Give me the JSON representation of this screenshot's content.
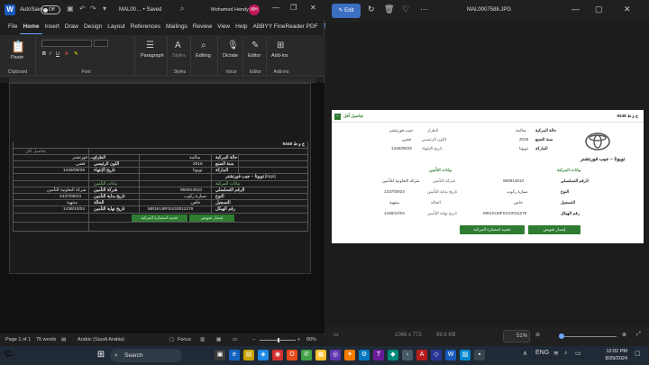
{
  "word": {
    "autosave_label": "AutoSave",
    "autosave_state": "Off",
    "doc_title": "MAL00… • Saved",
    "user_name": "Mohamed Hendy",
    "user_initials": "MH",
    "tabs": [
      "File",
      "Home",
      "Insert",
      "Draw",
      "Design",
      "Layout",
      "References",
      "Mailings",
      "Review",
      "View",
      "Help",
      "ABBYY FineReader PDF",
      "Table"
    ],
    "active_tab": "Home",
    "ribbon": {
      "paste": "Paste",
      "clipboard": "Clipboard",
      "font": "Font",
      "paragraph": "Paragraph",
      "styles": "Styles",
      "styles_group": "Styles",
      "editing": "Editing",
      "dictate": "Dictate",
      "voice": "Voice",
      "editor": "Editor",
      "editor_group": "Editor",
      "addins": "Add-ins",
      "addins_group": "Add-ins"
    },
    "doc": {
      "plate": "ج و ط 9348",
      "details_link": "تفاصيل أقل",
      "logo": "[logo]",
      "rows": [
        {
          "a": "حالة المركبة",
          "b": "سالمة",
          "c": "الطراز",
          "d": "جيب فورتشنر"
        },
        {
          "a": "سنة الصنع",
          "b": "2016",
          "c": "اللون الرئيسي",
          "d": "فضي"
        },
        {
          "a": "الماركة",
          "b": "تويوتا",
          "c": "تاريخ الإنتهاء",
          "d": "1446/09/25"
        },
        {
          "a": "تويوتا – جيب فورتشنر",
          "b": "",
          "c": "",
          "d": ""
        },
        {
          "a": "بيانات المركبة",
          "b": "",
          "c": "بيانات التأمين",
          "d": ""
        },
        {
          "a": "الرقم التسلسلي",
          "b": "950914510",
          "c": "شركة التأمين",
          "d": "شركة التعاونية للتأمين"
        },
        {
          "a": "النوع",
          "b": "سيارة ركوب",
          "c": "تاريخ بداية التأمين",
          "d": "1437/09/24"
        },
        {
          "a": "التسجيل",
          "b": "خاص",
          "c": "الحالة",
          "d": "منتهية"
        },
        {
          "a": "رقم الهيكل",
          "b": "MR1KU8FS1G0011276",
          "c": "تاريخ نهاية التأمين",
          "d": "1438/10/04"
        }
      ],
      "btn_issue": "إصدار تفويض",
      "btn_renew": "تجديد استمارة المركبة"
    },
    "status": {
      "page": "Page 1 of 1",
      "words": "75 words",
      "language": "Arabic (Saudi Arabia)",
      "focus": "Focus",
      "zoom": "80%"
    }
  },
  "photos": {
    "edit": "Edit",
    "file_name": "MAL0007588.JPG",
    "dimensions": "1069 x 772",
    "size": "99.6 KB",
    "zoom": "51%",
    "image": {
      "plate": "ج و ط 9348",
      "details_link": "تفاصيل أقل",
      "car_title": "تويوتا – جيب فورتشنر",
      "vehicle_section": "بيانات المركبة",
      "insurance_section": "بيانات التأمين",
      "fields_top": [
        {
          "label": "حالة المركبة",
          "value": "سالمة"
        },
        {
          "label": "سنة الصنع",
          "value": "2016"
        },
        {
          "label": "الماركة",
          "value": "تويوتا"
        }
      ],
      "fields_top_right": [
        {
          "label": "الطراز",
          "value": "جيب فورتشنر"
        },
        {
          "label": "اللون الرئيسي",
          "value": "فضي"
        },
        {
          "label": "تاريخ الإنتهاء",
          "value": "1446/09/25"
        }
      ],
      "vehicle_fields": [
        {
          "label": "الرقم التسلسلي",
          "value": "950914510"
        },
        {
          "label": "النوع",
          "value": "سيارة ركوب"
        },
        {
          "label": "التسجيل",
          "value": "خاص"
        },
        {
          "label": "رقم الهيكل",
          "value": "MR1KU8FS1G0011276"
        }
      ],
      "insurance_fields": [
        {
          "label": "شركة التأمين",
          "value": "شركة التعاونية للتأمين"
        },
        {
          "label": "تاريخ بداية التأمين",
          "value": "1437/09/24"
        },
        {
          "label": "الحالة",
          "value": "منتهية"
        },
        {
          "label": "تاريخ نهاية التأمين",
          "value": "1438/10/04"
        }
      ],
      "btn_issue": "إصدار تفويض",
      "btn_renew": "تجديد استمارة المركبة"
    }
  },
  "taskbar": {
    "search": "Search",
    "time": "12:02 PM",
    "date": "8/29/2024",
    "language": "ENG"
  },
  "colors": {
    "accent": "#3b6fc2",
    "green": "#2e7d32",
    "word_blue": "#185abd"
  }
}
